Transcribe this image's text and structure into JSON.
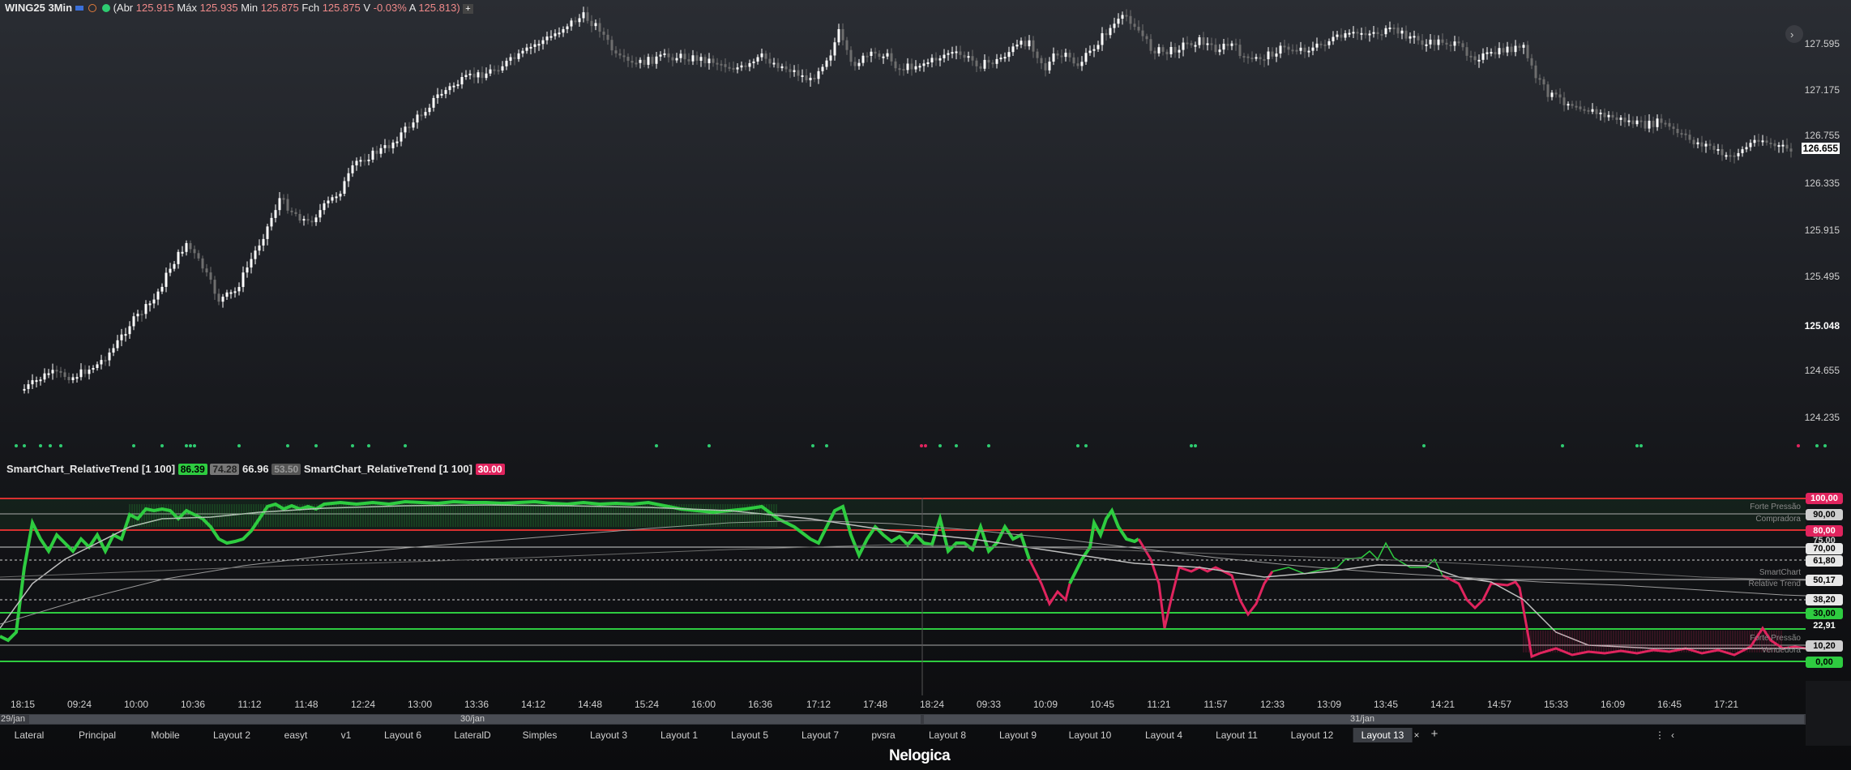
{
  "header": {
    "symbol": "WING25 3Min",
    "abr_label": "(Abr",
    "abr": "125.915",
    "max_label": "Máx",
    "max": "125.935",
    "min_label": "Min",
    "min": "125.875",
    "fch_label": "Fch",
    "fch": "125.875",
    "var_label": "V",
    "var": "-0.03%",
    "a_label": "A",
    "a": "125.813)",
    "add_symbol": "+"
  },
  "price_axis": {
    "labels": [
      "127.595",
      "127.175",
      "126.755",
      "126.335",
      "125.915",
      "125.495",
      "125.048",
      "124.655",
      "124.235"
    ],
    "current_price": "126.655"
  },
  "indicator": {
    "legend_name_1": "SmartChart_RelativeTrend [1 100]",
    "val1": "86.39",
    "val2": "74.28",
    "val3": "66.96",
    "val4": "53.50",
    "legend_name_2": "SmartChart_RelativeTrend [1 100]",
    "val5": "30.00",
    "levels": [
      "100,00",
      "90,00",
      "80,00",
      "75,00",
      "70,00",
      "61,80",
      "50,17",
      "38,20",
      "30,00",
      "22,91",
      "10,20",
      "0,00"
    ],
    "zone_labels": [
      "Forte Pressão",
      "Compradora",
      "SmartChart",
      "Relative Trend",
      "Forte Pressão",
      "Vendedora"
    ]
  },
  "time_axis": [
    "18:15",
    "09:24",
    "10:00",
    "10:36",
    "11:12",
    "11:48",
    "12:24",
    "13:00",
    "13:36",
    "14:12",
    "14:48",
    "15:24",
    "16:00",
    "16:36",
    "17:12",
    "17:48",
    "18:24",
    "09:33",
    "10:09",
    "10:45",
    "11:21",
    "11:57",
    "12:33",
    "13:09",
    "13:45",
    "14:21",
    "14:57",
    "15:33",
    "16:09",
    "16:45",
    "17:21"
  ],
  "dates": [
    "29/jan",
    "30/jan",
    "31/jan"
  ],
  "tabs": [
    "Lateral",
    "Principal",
    "Mobile",
    "Layout 2",
    "easyt",
    "v1",
    "Layout 6",
    "LateralD",
    "Simples",
    "Layout 3",
    "Layout 1",
    "Layout 5",
    "Layout 7",
    "pvsra",
    "Layout 8",
    "Layout 9",
    "Layout 10",
    "Layout 4",
    "Layout 11",
    "Layout 12",
    "Layout 13"
  ],
  "active_tab": "Layout 13",
  "brand": "Nelogica",
  "colors": {
    "up": "#ffffff",
    "down": "#6e6e6e",
    "green": "#2ecc40",
    "red": "#e0245e",
    "accent_line": "#d93030"
  }
}
